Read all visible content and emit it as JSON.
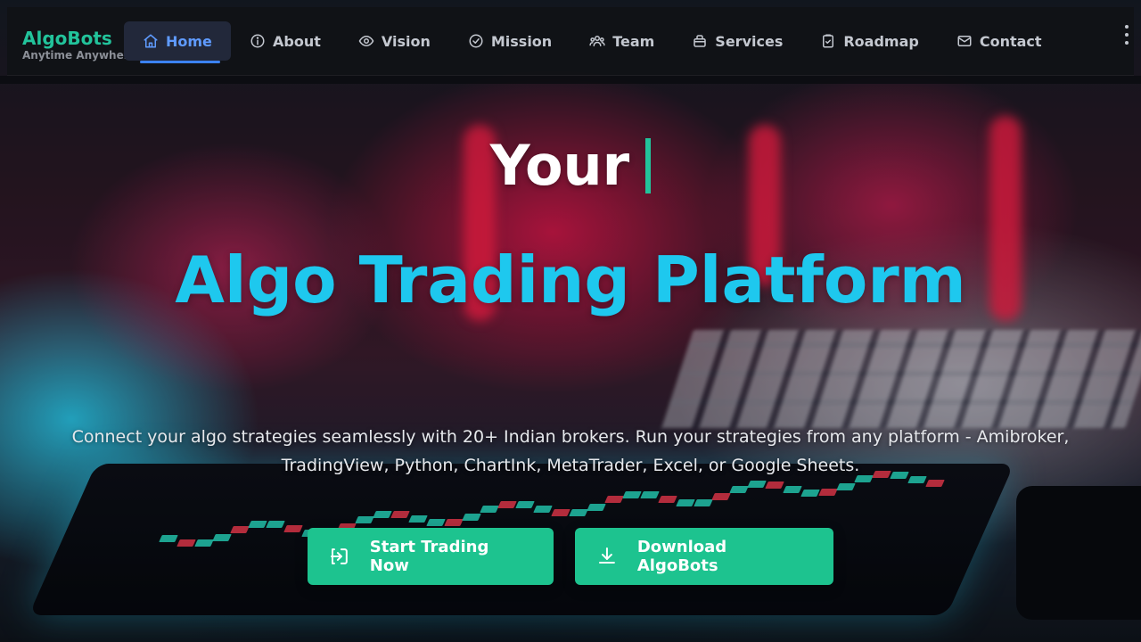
{
  "brand": {
    "title": "AlgoBots",
    "subtitle": "Anytime Anywhere",
    "color": "#22c39b"
  },
  "nav": {
    "items": [
      {
        "label": "Home",
        "icon": "home-icon",
        "active": true
      },
      {
        "label": "About",
        "icon": "info-icon"
      },
      {
        "label": "Vision",
        "icon": "eye-icon"
      },
      {
        "label": "Mission",
        "icon": "check-circle-icon"
      },
      {
        "label": "Team",
        "icon": "users-icon"
      },
      {
        "label": "Services",
        "icon": "briefcase-icon"
      },
      {
        "label": "Roadmap",
        "icon": "clipboard-check-icon"
      },
      {
        "label": "Contact",
        "icon": "mail-icon"
      }
    ],
    "more_icon": "more-vertical-icon",
    "active_color": "#5f9bff"
  },
  "hero": {
    "typed_prefix": "Your",
    "title": "Algo Trading Platform",
    "title_color": "#1ec8ee",
    "description": "Connect your algo strategies seamlessly with 20+ Indian brokers. Run your strategies from any platform - Amibroker, TradingView, Python, ChartInk, MetaTrader, Excel, or Google Sheets."
  },
  "cta": {
    "start_label": "Start Trading Now",
    "start_icon": "login-icon",
    "download_label": "Download AlgoBots",
    "download_icon": "download-icon",
    "button_color": "#1dc38f"
  }
}
